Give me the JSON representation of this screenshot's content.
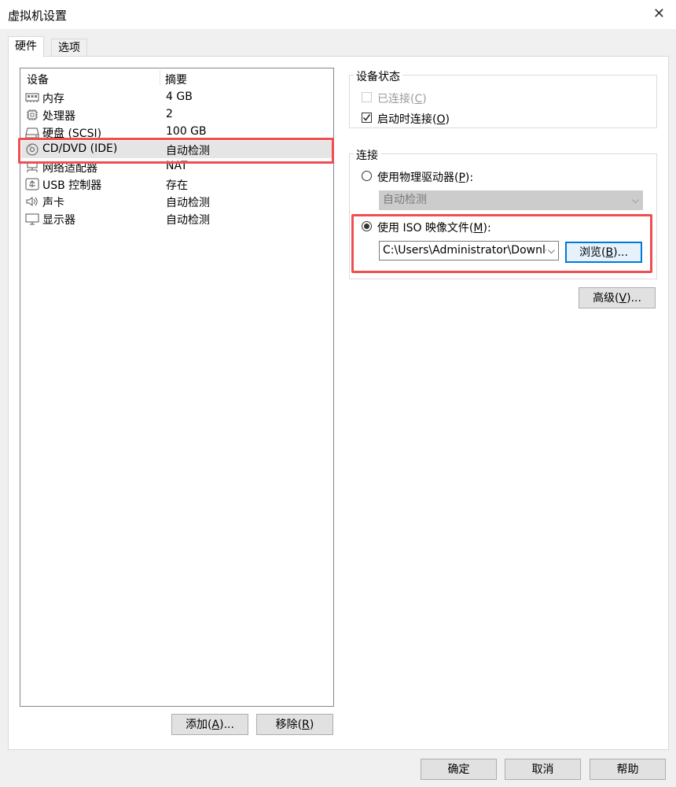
{
  "window": {
    "title": "虚拟机设置",
    "close_glyph": "✕"
  },
  "tabs": [
    {
      "label": "硬件",
      "active": true
    },
    {
      "label": "选项",
      "active": false
    }
  ],
  "device_list": {
    "headers": {
      "device": "设备",
      "summary": "摘要"
    },
    "rows": [
      {
        "icon": "memory-icon",
        "name": "内存",
        "summary": "4 GB"
      },
      {
        "icon": "processor-icon",
        "name": "处理器",
        "summary": "2"
      },
      {
        "icon": "harddisk-icon",
        "name": "硬盘 (SCSI)",
        "summary": "100 GB"
      },
      {
        "icon": "cd-dvd-icon",
        "name": "CD/DVD (IDE)",
        "summary": "自动检测",
        "selected": true
      },
      {
        "icon": "network-adapter-icon",
        "name": "网络适配器",
        "summary": "NAT"
      },
      {
        "icon": "usb-controller-icon",
        "name": "USB 控制器",
        "summary": "存在"
      },
      {
        "icon": "sound-card-icon",
        "name": "声卡",
        "summary": "自动检测"
      },
      {
        "icon": "display-icon",
        "name": "显示器",
        "summary": "自动检测"
      }
    ]
  },
  "left_buttons": {
    "add": {
      "text": "添加(",
      "key": "A",
      "suffix": ")..."
    },
    "remove": {
      "text": "移除(",
      "key": "R",
      "suffix": ")"
    }
  },
  "device_status": {
    "title": "设备状态",
    "connected": {
      "text": "已连接(",
      "key": "C",
      "suffix": ")",
      "checked": false,
      "disabled": true
    },
    "connect_at_power_on": {
      "text": "启动时连接(",
      "key": "O",
      "suffix": ")",
      "checked": true,
      "disabled": false
    }
  },
  "connection": {
    "title": "连接",
    "physical_drive": {
      "text": "使用物理驱动器(",
      "key": "P",
      "suffix": "):",
      "selected": false
    },
    "physical_drive_select": {
      "value": "自动检测",
      "disabled": true
    },
    "iso_image": {
      "text": "使用 ISO 映像文件(",
      "key": "M",
      "suffix": "):",
      "selected": true
    },
    "iso_path": {
      "value": "C:\\Users\\Administrator\\Downlo"
    },
    "browse": {
      "text": "浏览(",
      "key": "B",
      "suffix": ")..."
    }
  },
  "advanced": {
    "text": "高级(",
    "key": "V",
    "suffix": ")..."
  },
  "footer": {
    "ok": "确定",
    "cancel": "取消",
    "help": "帮助"
  },
  "colors": {
    "highlight": "#ee4f52",
    "focus": "#0078d7"
  }
}
